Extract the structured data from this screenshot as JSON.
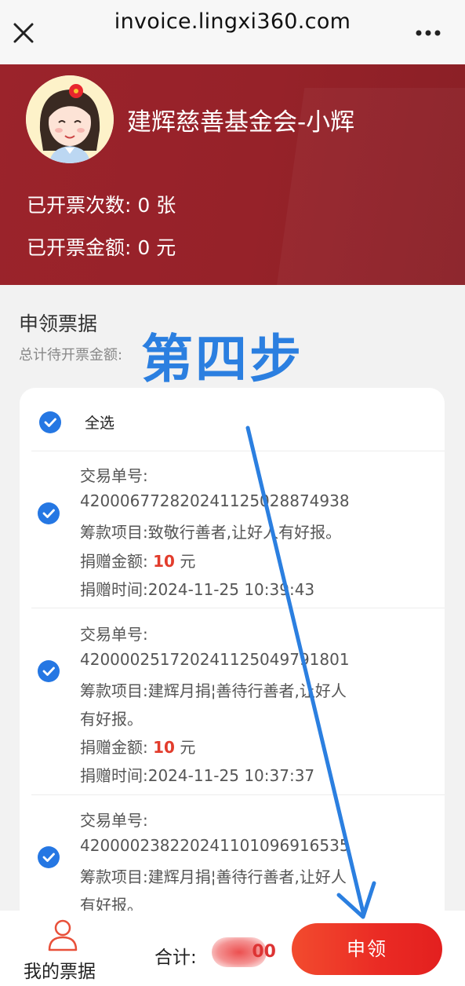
{
  "browser": {
    "url": "invoice.lingxi360.com",
    "close_icon": "close-icon",
    "more_icon": "more-icon"
  },
  "header": {
    "org_name": "建辉慈善基金会-小辉",
    "stats": [
      {
        "label": "已开票次数:",
        "value": "0 张"
      },
      {
        "label": "已开票金额:",
        "value": "0 元"
      }
    ]
  },
  "section": {
    "title": "申领票据",
    "subtitle": "总计待开票金额:",
    "step_annotation": "第四步"
  },
  "list": {
    "select_all_label": "全选",
    "records": [
      {
        "lines": [
          {
            "text": "交易单号:"
          },
          {
            "text": "420006772820241125028874938"
          },
          {
            "text": "筹款项目:致敬行善者,让好人有好报。"
          },
          {
            "label": "捐赠金额:",
            "amount": "10",
            "unit": "元"
          },
          {
            "text": "捐赠时间:2024-11-25 10:39:43"
          }
        ]
      },
      {
        "lines": [
          {
            "text": "交易单号:"
          },
          {
            "text": "420000251720241125049791801"
          },
          {
            "text": "筹款项目:建辉月捐¦善待行善者,让好人"
          },
          {
            "text": "有好报。"
          },
          {
            "label": "捐赠金额:",
            "amount": "10",
            "unit": "元"
          },
          {
            "text": "捐赠时间:2024-11-25 10:37:37"
          }
        ]
      },
      {
        "lines": [
          {
            "text": "交易单号:"
          },
          {
            "text": "420000238220241101096916535"
          },
          {
            "text": "筹款项目:建辉月捐¦善待行善者,让好人"
          },
          {
            "text": "有好报。"
          }
        ]
      }
    ]
  },
  "footer": {
    "my_tickets_label": "我的票据",
    "total_label": "合计:",
    "total_value_partial": "00",
    "apply_button_label": "申领"
  },
  "colors": {
    "banner": "#962229",
    "check_blue": "#2577e3",
    "amount_red": "#e23c2c",
    "button_red": "#ea2a24",
    "annotation_blue": "#2b7fe0"
  }
}
